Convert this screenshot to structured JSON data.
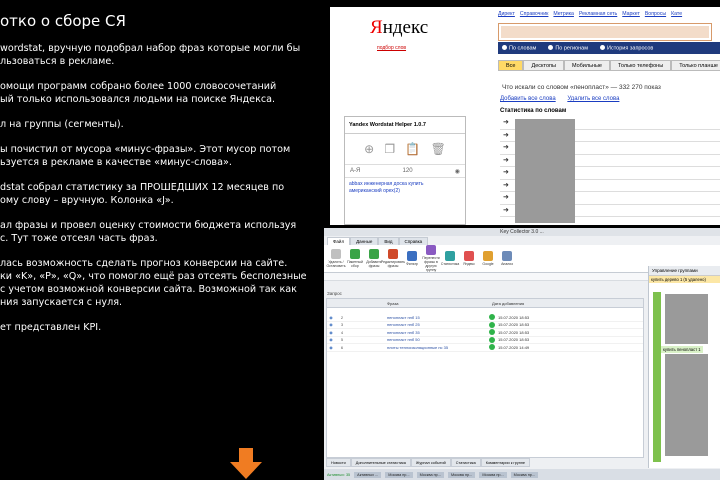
{
  "slide": {
    "title": "отко о сборе СЯ",
    "paragraphs": [
      "wordstat, вручную подобрал набор фраз которые могли бы\nльзоваться в рекламе.",
      "омощи программ собрано более 1000 словосочетаний\nый только использовался людьми на поиске Яндекса.",
      "л на группы (сегменты).",
      "ы почистил от мусора «минус-фразы». Этот мусор потом\nьзуется в рекламе в качестве «минус-слова».",
      "dstat собрал статистику за ПРОШЕДШИХ 12 месяцев по\nому слову – вручную. Колонка «J».",
      "ал фразы и провел оценку стоимости бюджета используя\nс. Тут тоже отсеял часть фраз.",
      "лась возможность сделать прогноз конверсии на сайте.\nки «K», «P», «Q», что помогло ещё раз отсеять бесполезные\nс учетом возможной конверсии сайта. Возможной так как\nния запускается с нуля.",
      "ет представлен KPI."
    ],
    "arrow_color": "#f07c22"
  },
  "yandex": {
    "logo": "Яндекс",
    "logo_sub": "подбор слов",
    "topnav": [
      "Директ",
      "Справочник",
      "Метрика",
      "Рекламная сеть",
      "Маркет",
      "Вопросы",
      "Кате"
    ],
    "radios": [
      "По словам",
      "По регионам",
      "История запросов"
    ],
    "tabs": [
      "Все",
      "Десктопы",
      "Мобильные",
      "Только телефоны",
      "Только планше"
    ],
    "what_searched": "Что искали со словом «пенопласт» — 332 270 показ",
    "links": [
      "Добавить все слова",
      "Удалить все слова"
    ],
    "stat_header": "Статистика по словам",
    "helper": {
      "title": "Yandex Wordstat Helper 1.0.7",
      "sort_label": "А-Я",
      "count": "120",
      "phrase_link": "abbax инженерная доска купить\nамериканский орех(2)"
    },
    "colors": {
      "logo_red": "#ee0000",
      "radio_bar": "#1f3a7d",
      "active_tab": "#ffd966"
    }
  },
  "kc": {
    "title": "Key Collector 3.0 ...",
    "tabs": [
      "Файл",
      "Данные",
      "Вид",
      "Справка"
    ],
    "toolbar": [
      {
        "label": "Удалить / Остановить",
        "color": "#c0c0c0"
      },
      {
        "label": "Пакетный сбор",
        "color": "#3aa447"
      },
      {
        "label": "Добавить фразы",
        "color": "#3aa447"
      },
      {
        "label": "Редактировать фразы",
        "color": "#d04a2a"
      },
      {
        "label": "Фильтр",
        "color": "#3b6fc1"
      },
      {
        "label": "Перенести фразы в другую группу",
        "color": "#8a5ac2"
      },
      {
        "label": "Статистика",
        "color": "#2fa0a0"
      },
      {
        "label": "Яндекс",
        "color": "#e05050"
      },
      {
        "label": "Google",
        "color": "#e0a030"
      },
      {
        "label": "Анализ",
        "color": "#6d8bb8"
      }
    ],
    "search_label": "Запрос",
    "columns": [
      "Фраза",
      "Дата добавления"
    ],
    "rows": [
      {
        "n": "2",
        "phrase": "пенопласт пнб 15",
        "date": "15.07.2020 18:53"
      },
      {
        "n": "3",
        "phrase": "пенопласт пнб 25",
        "date": "15.07.2020 18:53"
      },
      {
        "n": "4",
        "phrase": "пенопласт пнб 35",
        "date": "15.07.2020 18:53"
      },
      {
        "n": "5",
        "phrase": "пенопласт пнб 50",
        "date": "15.07.2020 18:53"
      },
      {
        "n": "6",
        "phrase": "плиты теплоизоляционные пс 35",
        "date": "15.07.2020 14:49"
      }
    ],
    "bottom_tabs": [
      "Новости",
      "Дополнительные статистика",
      "Журнал событий",
      "Статистика",
      "Комментарии к группе"
    ],
    "status": [
      "Активных: 35",
      "Активных ...",
      "Москва пр...",
      "Москва пр...",
      "Москва пр...",
      "Москва пр...",
      "Москва пр..."
    ],
    "groups": {
      "title": "Управление группами",
      "items": [
        {
          "label": "купить дерево 1 (5 удалено)",
          "hl": "hl1"
        },
        {
          "label": "купить пенопласт 1",
          "hl": "hl2"
        }
      ]
    }
  }
}
